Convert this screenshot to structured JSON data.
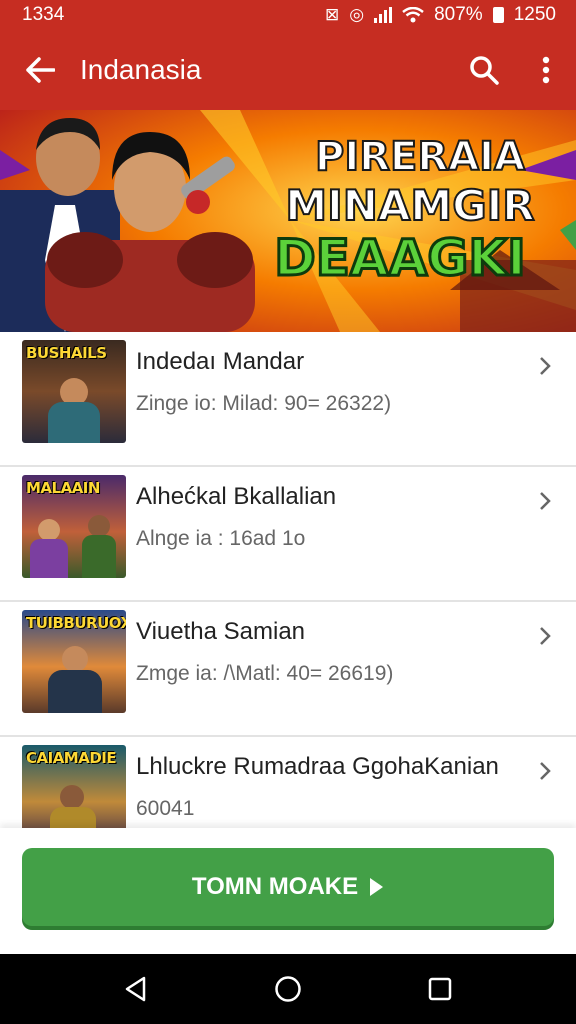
{
  "status": {
    "time": "1334",
    "battery_pct": "807%",
    "clock": "1250",
    "icons": [
      "nfc-icon",
      "vibrate-icon",
      "signal-icon",
      "wifi-icon",
      "battery-icon"
    ]
  },
  "app_bar": {
    "title": "Indanasia",
    "back_icon": "arrow-left-icon",
    "search_icon": "search-icon",
    "menu_icon": "more-vert-icon"
  },
  "banner": {
    "line1": "PIRERAIA",
    "line2": "MINAMGIR",
    "line3": "DEAAGKI"
  },
  "items": [
    {
      "title": "Indedaı Mandar",
      "subtitle": "Zinge io: Milad: 90= 26322)",
      "thumb_label": "BUSHAILS"
    },
    {
      "title": "Alhećkal Bkallalian",
      "subtitle": "Alnge ia : 16ad 1o",
      "thumb_label": "MALAAIN"
    },
    {
      "title": "Viuetha Samian",
      "subtitle": "Zmge ia: /\\Matl: 40= 26619)",
      "thumb_label": "TUIBBURUOX"
    },
    {
      "title": "Lhluckre Rumadraa GgohaKanian",
      "subtitle": "60041",
      "thumb_label": "CAIAMADIE"
    }
  ],
  "cta": {
    "label": "TOMN MOAKE"
  },
  "colors": {
    "primary": "#c62d22",
    "accent": "#43a047"
  }
}
